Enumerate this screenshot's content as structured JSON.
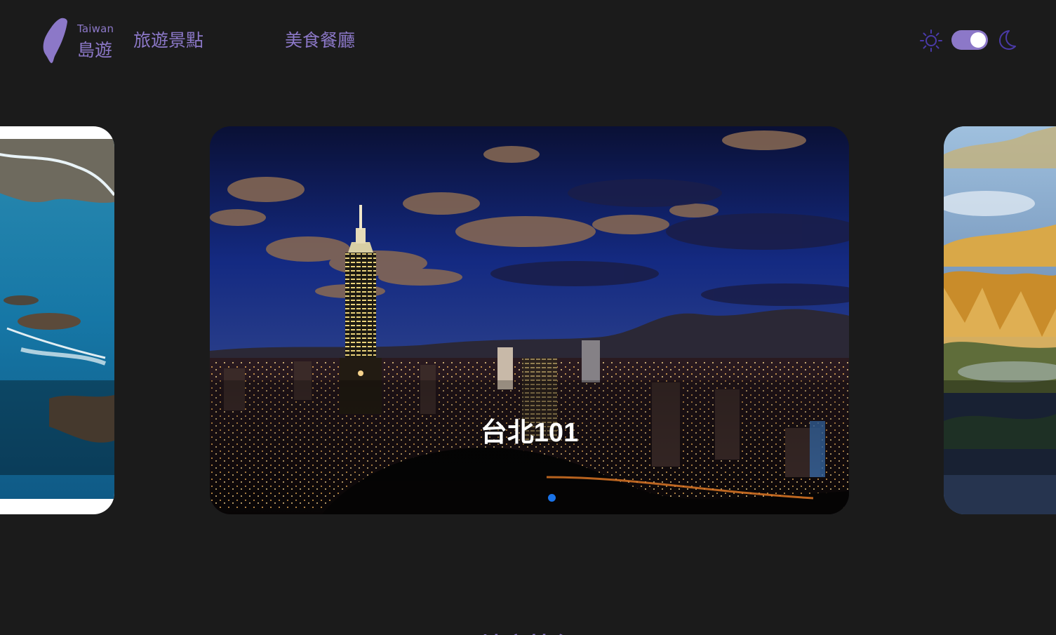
{
  "header": {
    "logo": {
      "en": "Taiwan",
      "zh": "島遊"
    },
    "nav": [
      {
        "label": "旅遊景點"
      },
      {
        "label": "美食餐廳"
      }
    ],
    "theme": {
      "light_icon": "sun-icon",
      "dark_icon": "moon-icon",
      "dark_mode_on": true
    }
  },
  "carousel": {
    "active_index": 1,
    "slides": [
      {
        "title": "",
        "image": "coastline-photo"
      },
      {
        "title": "台北101",
        "image": "taipei-night-skyline-photo"
      },
      {
        "title": "",
        "image": "misty-badlands-mountain-photo"
      }
    ]
  },
  "section": {
    "title": "地方特色"
  },
  "colors": {
    "accent": "#8c78c8",
    "background": "#1b1b1b",
    "active_dot": "#1a73e8"
  }
}
